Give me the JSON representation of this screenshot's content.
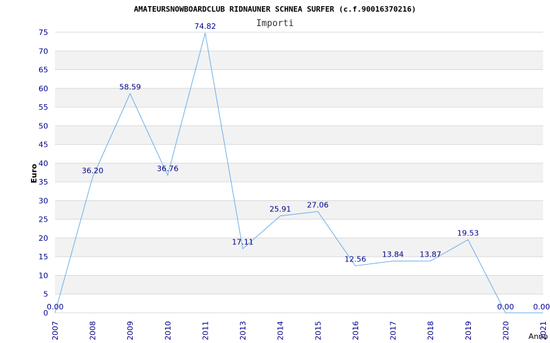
{
  "chart_data": {
    "type": "line",
    "title": "AMATEURSNOWBOARDCLUB RIDNAUNER SCHNEA SURFER (c.f.90016370216)",
    "subtitle": "Importi",
    "xlabel": "Anno",
    "ylabel": "Euro",
    "ylim": [
      0,
      75
    ],
    "yticks": [
      "0",
      "5",
      "10",
      "15",
      "20",
      "25",
      "30",
      "35",
      "40",
      "45",
      "50",
      "55",
      "60",
      "65",
      "70",
      "75"
    ],
    "categories": [
      "2007",
      "2008",
      "2009",
      "2010",
      "2011",
      "2013",
      "2014",
      "2015",
      "2016",
      "2017",
      "2018",
      "2019",
      "2020",
      "2021"
    ],
    "values": [
      0.0,
      36.2,
      58.59,
      36.76,
      74.82,
      17.11,
      25.91,
      27.06,
      12.56,
      13.84,
      13.87,
      19.53,
      0.0,
      0.0
    ],
    "labels": [
      "0.00",
      "36.20",
      "58.59",
      "36.76",
      "74.82",
      "17.11",
      "25.91",
      "27.06",
      "12.56",
      "13.84",
      "13.87",
      "19.53",
      "0.00",
      "0.00"
    ],
    "grid": true,
    "colors": {
      "line": "#6aaee8",
      "band": "#f2f2f2",
      "gridline": "#d9d9d9",
      "axis_text": "#00008b",
      "data_label": "#00008b",
      "title": "#000000"
    }
  }
}
